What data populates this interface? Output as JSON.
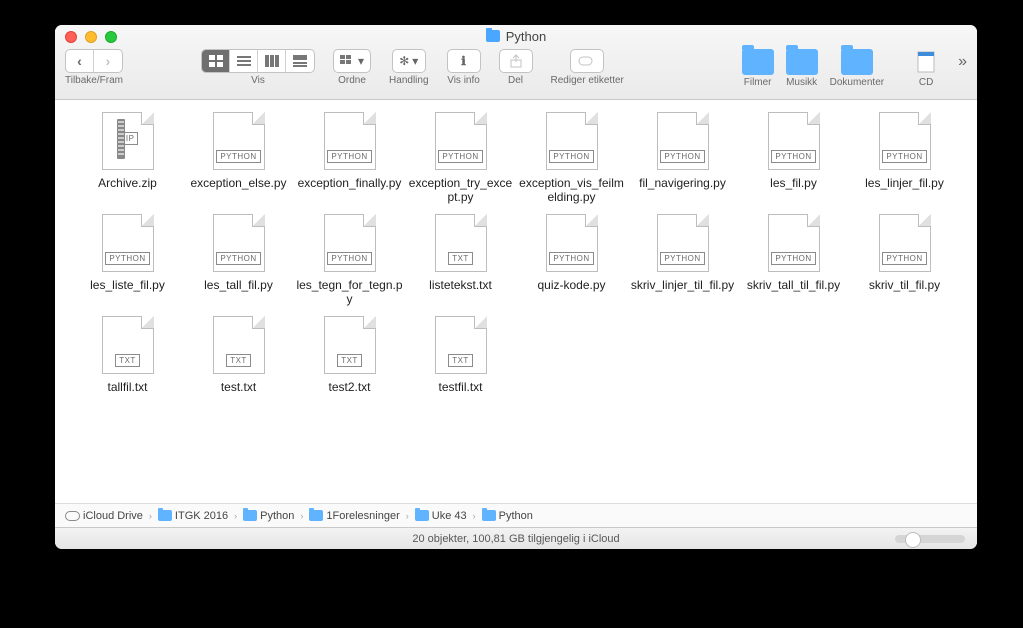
{
  "window": {
    "title": "Python",
    "traffic": [
      "close",
      "minimize",
      "zoom"
    ]
  },
  "toolbar": {
    "back_forward_label": "Tilbake/Fram",
    "view_label": "Vis",
    "arrange_btn": "Ordne",
    "action_btn": "Handling",
    "info_btn": "Vis info",
    "share_btn": "Del",
    "tags_btn": "Rediger etiketter",
    "folder_shortcuts": [
      {
        "label": "Filmer"
      },
      {
        "label": "Musikk"
      },
      {
        "label": "Dokumenter"
      }
    ],
    "cd_label": "CD",
    "more": "»"
  },
  "files": [
    {
      "name": "Archive.zip",
      "kind": "ZIP"
    },
    {
      "name": "exception_else.py",
      "kind": "PYTHON"
    },
    {
      "name": "exception_finally.py",
      "kind": "PYTHON"
    },
    {
      "name": "exception_try_except.py",
      "kind": "PYTHON"
    },
    {
      "name": "exception_vis_feilmelding.py",
      "kind": "PYTHON"
    },
    {
      "name": "fil_navigering.py",
      "kind": "PYTHON"
    },
    {
      "name": "les_fil.py",
      "kind": "PYTHON"
    },
    {
      "name": "les_linjer_fil.py",
      "kind": "PYTHON"
    },
    {
      "name": "les_liste_fil.py",
      "kind": "PYTHON"
    },
    {
      "name": "les_tall_fil.py",
      "kind": "PYTHON"
    },
    {
      "name": "les_tegn_for_tegn.py",
      "kind": "PYTHON"
    },
    {
      "name": "listetekst.txt",
      "kind": "TXT"
    },
    {
      "name": "quiz-kode.py",
      "kind": "PYTHON"
    },
    {
      "name": "skriv_linjer_til_fil.py",
      "kind": "PYTHON"
    },
    {
      "name": "skriv_tall_til_fil.py",
      "kind": "PYTHON"
    },
    {
      "name": "skriv_til_fil.py",
      "kind": "PYTHON"
    },
    {
      "name": "tallfil.txt",
      "kind": "TXT"
    },
    {
      "name": "test.txt",
      "kind": "TXT"
    },
    {
      "name": "test2.txt",
      "kind": "TXT"
    },
    {
      "name": "testfil.txt",
      "kind": "TXT"
    }
  ],
  "path": [
    {
      "label": "iCloud Drive",
      "type": "cloud"
    },
    {
      "label": "ITGK 2016",
      "type": "folder"
    },
    {
      "label": "Python",
      "type": "folder"
    },
    {
      "label": "1Forelesninger",
      "type": "folder"
    },
    {
      "label": "Uke 43",
      "type": "folder"
    },
    {
      "label": "Python",
      "type": "folder"
    }
  ],
  "status": "20 objekter, 100,81 GB tilgjengelig i iCloud"
}
